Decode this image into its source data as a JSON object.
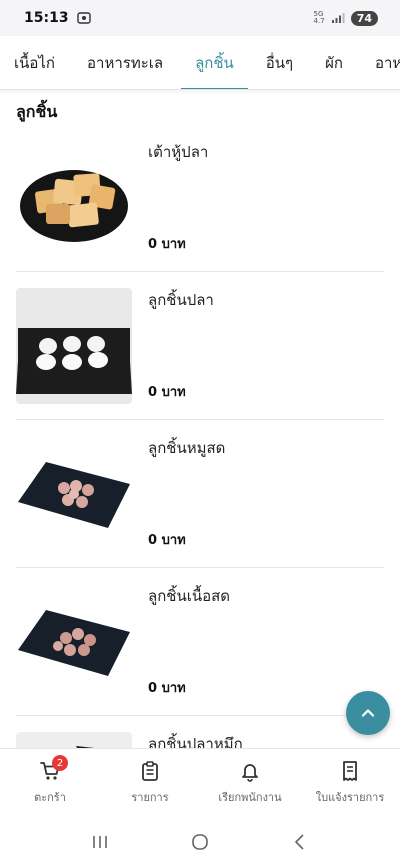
{
  "status": {
    "time": "15:13",
    "network_top": "5G",
    "network_bottom": "4.7",
    "battery": "74"
  },
  "tabs": [
    {
      "label": "เนื้อไก่",
      "active": false
    },
    {
      "label": "อาหารทะเล",
      "active": false
    },
    {
      "label": "ลูกชิ้น",
      "active": true
    },
    {
      "label": "อื่นๆ",
      "active": false
    },
    {
      "label": "ผัก",
      "active": false
    },
    {
      "label": "อาห",
      "active": false
    }
  ],
  "section_title": "ลูกชิ้น",
  "items": [
    {
      "name": "เต้าหู้ปลา",
      "price": "0 บาท"
    },
    {
      "name": "ลูกชิ้นปลา",
      "price": "0 บาท"
    },
    {
      "name": "ลูกชิ้นหมูสด",
      "price": "0 บาท"
    },
    {
      "name": "ลูกชิ้นเนื้อสด",
      "price": "0 บาท"
    },
    {
      "name": "ลูกชิ้นปลาหมึก",
      "price": ""
    }
  ],
  "bottom_nav": {
    "cart": {
      "label": "ตะกร้า",
      "badge": "2"
    },
    "orders": {
      "label": "รายการ"
    },
    "call_staff": {
      "label": "เรียกพนักงาน"
    },
    "bill": {
      "label": "ใบแจ้งรายการ"
    }
  },
  "colors": {
    "accent": "#3a8ea0",
    "badge": "#e53935"
  }
}
